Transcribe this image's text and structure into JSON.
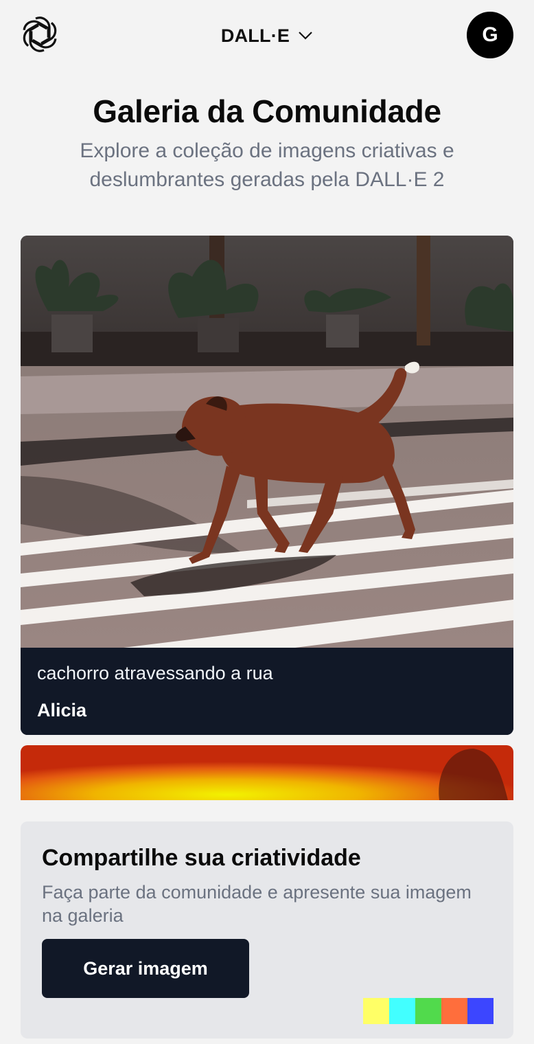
{
  "header": {
    "logo_icon": "openai-logo-icon",
    "model_label": "DALL·E",
    "dropdown_icon": "chevron-down-icon",
    "avatar_initial": "G"
  },
  "hero": {
    "title": "Galeria da Comunidade",
    "subtitle": "Explore a coleção de imagens criativas e deslumbrantes geradas pela  DALL·E 2"
  },
  "gallery": {
    "items": [
      {
        "prompt": "cachorro atravessando a rua",
        "author": "Alicia"
      }
    ]
  },
  "share": {
    "title": "Compartilhe sua criatividade",
    "description": "Faça parte da comunidade e apresente sua imagem na galeria",
    "button_label": "Gerar imagem",
    "swatch_colors": [
      "#ffff66",
      "#42ffff",
      "#51da4c",
      "#ff6e3c",
      "#3c46ff"
    ]
  },
  "colors": {
    "background": "#f3f3f3",
    "card_dark": "#111827",
    "muted_text": "#6b7280",
    "share_panel": "#e6e7ea"
  }
}
